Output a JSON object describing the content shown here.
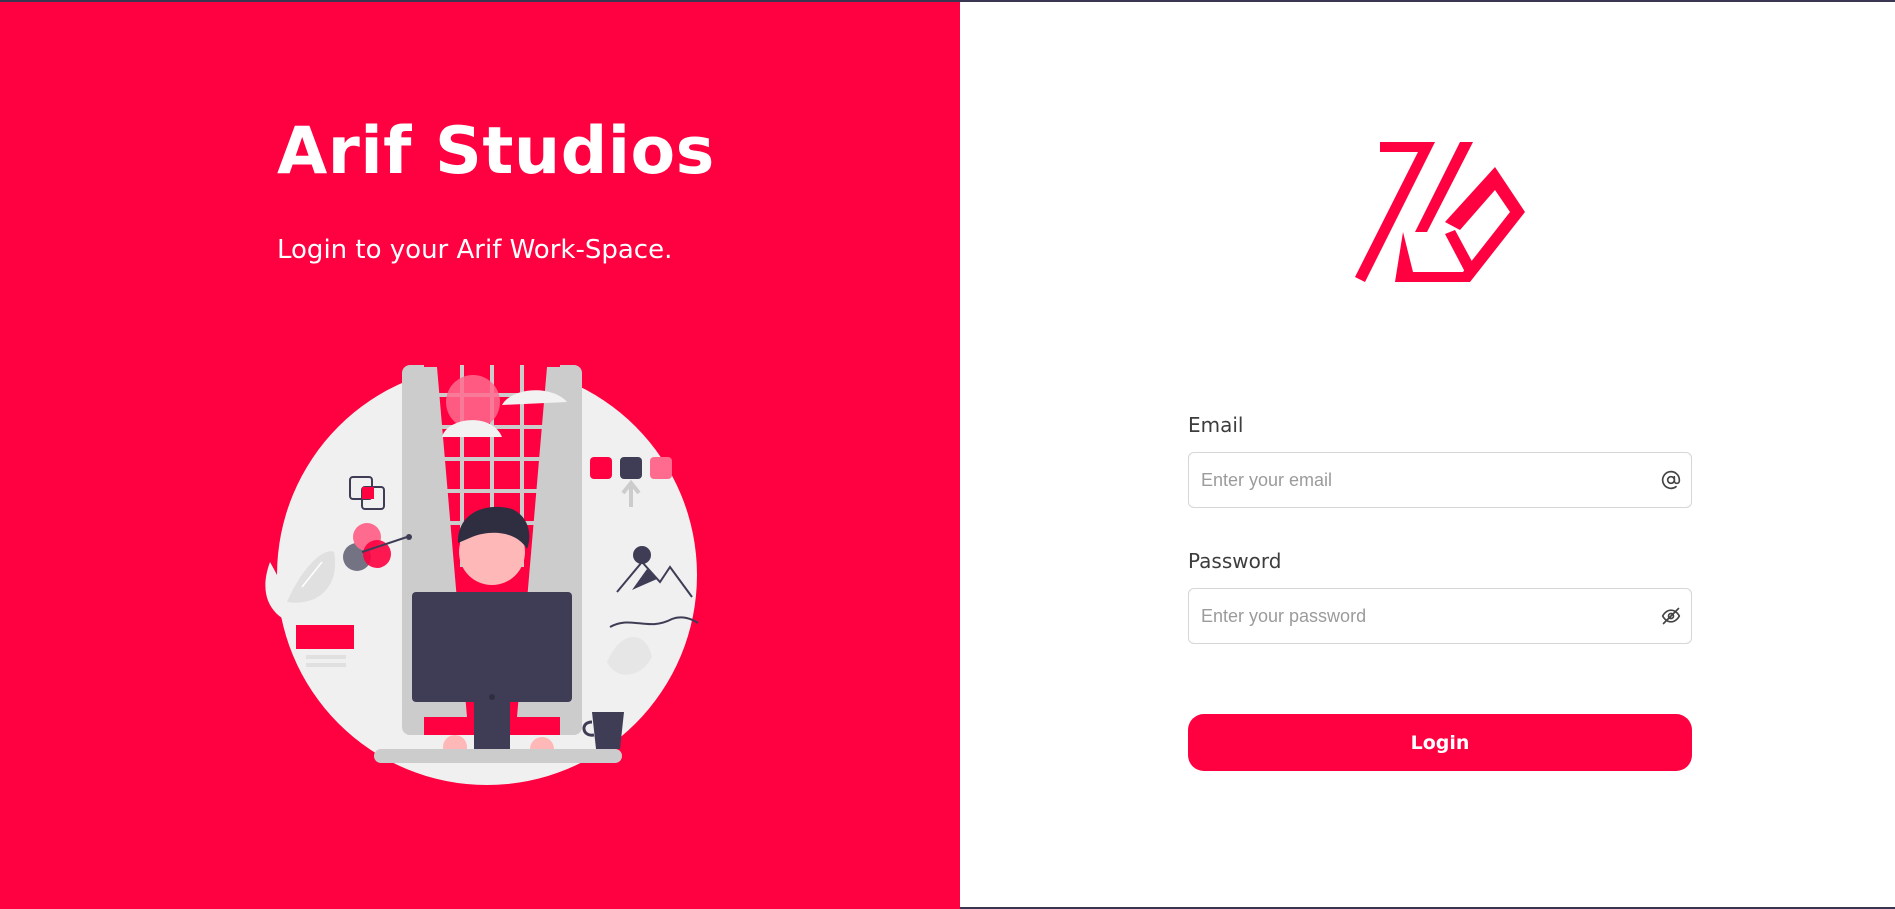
{
  "brand": {
    "title": "Arif Studios",
    "subtitle": "Login to your Arif Work-Space."
  },
  "colors": {
    "accent": "#ff0040",
    "dark": "#3f3d56",
    "light_gray": "#f2f2f2",
    "mid_gray": "#cccccc",
    "skin": "#ffb8b8"
  },
  "logo": {
    "icon": "arif-studios-logo-icon"
  },
  "form": {
    "email": {
      "label": "Email",
      "placeholder": "Enter your email",
      "value": "",
      "icon": "at-sign-icon"
    },
    "password": {
      "label": "Password",
      "placeholder": "Enter your password",
      "value": "",
      "icon": "eye-off-icon"
    },
    "submit_label": "Login"
  }
}
